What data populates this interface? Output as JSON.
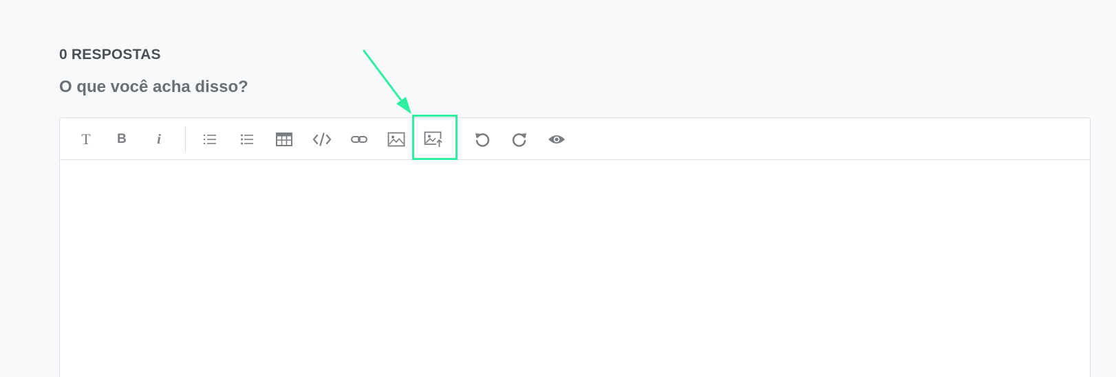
{
  "responses": {
    "count_label": "0 RESPOSTAS"
  },
  "prompt": {
    "heading": "O que você acha disso?"
  },
  "toolbar": {
    "text_label": "T",
    "bold_label": "B",
    "italic_label": "i",
    "icons": [
      "text-icon",
      "bold-icon",
      "italic-icon",
      "ordered-list-icon",
      "unordered-list-icon",
      "table-icon",
      "code-icon",
      "link-icon",
      "image-icon",
      "image-upload-icon",
      "undo-icon",
      "redo-icon",
      "preview-eye-icon"
    ]
  },
  "editor": {
    "content": ""
  },
  "colors": {
    "background": "#f8f9fb",
    "icon": "#7a7d82",
    "highlight": "#2ef0a0",
    "heading_dark": "#4a4f57",
    "heading_light": "#6a6f77"
  }
}
